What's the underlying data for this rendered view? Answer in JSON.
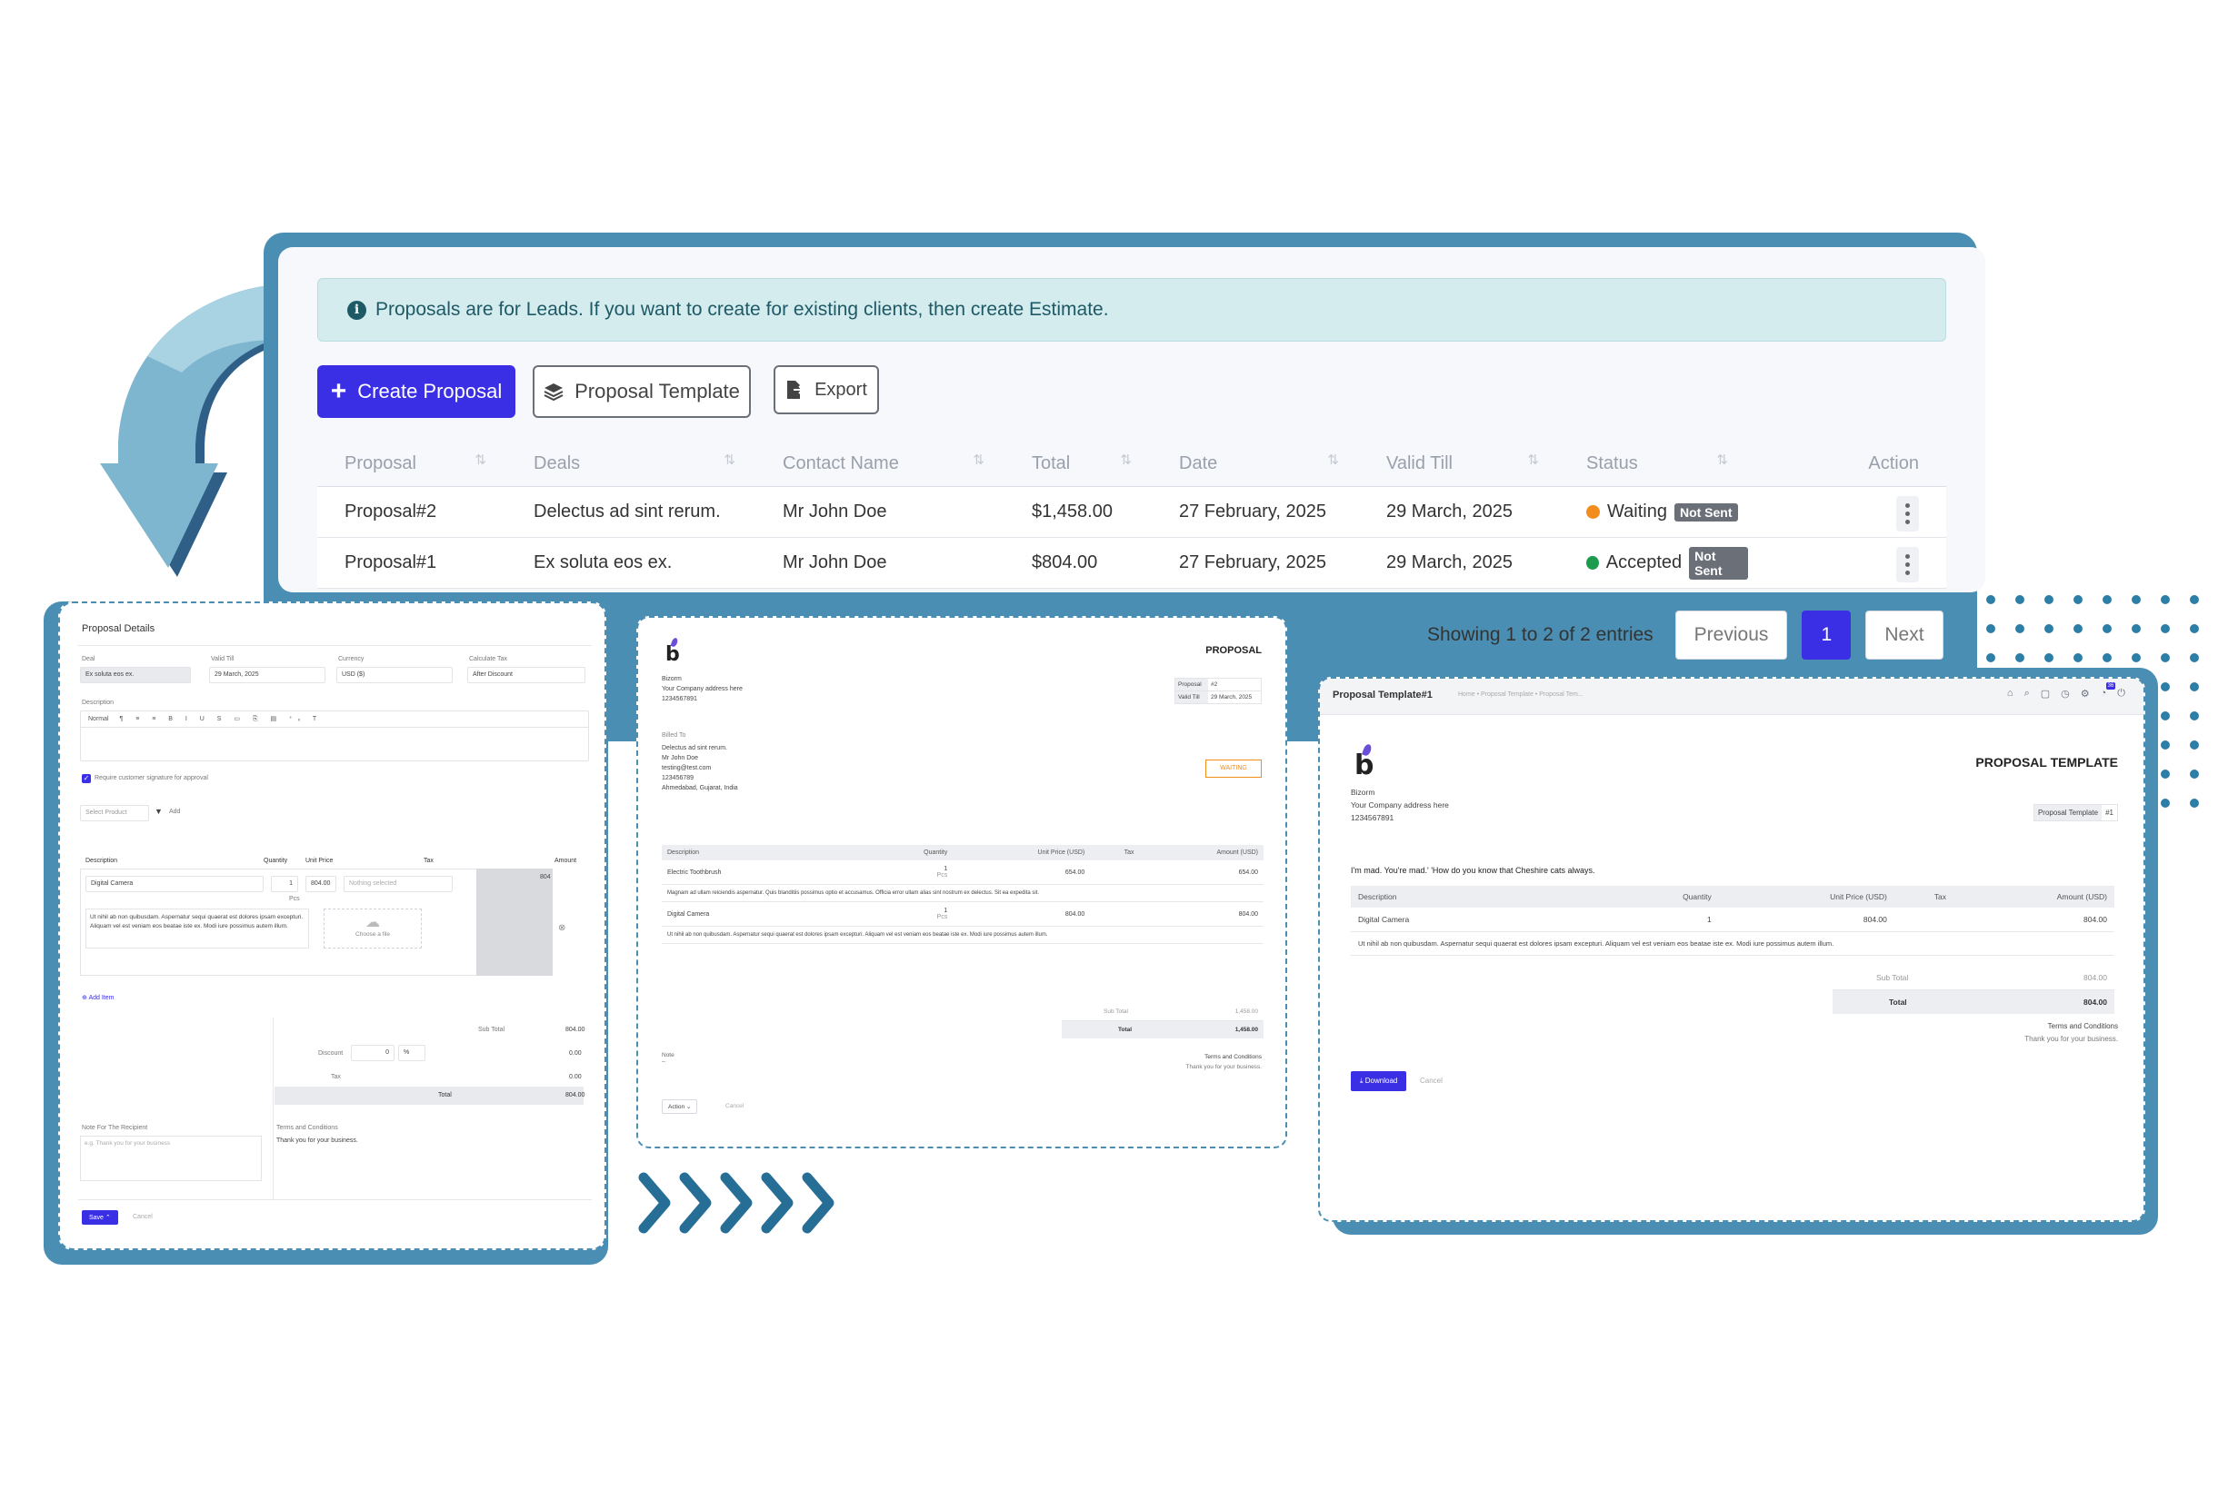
{
  "alert": {
    "icon": "info-icon",
    "text": "Proposals are for Leads. If you want to create for existing clients, then create Estimate."
  },
  "toolbar": {
    "create_label": "Create Proposal",
    "template_label": "Proposal Template",
    "export_label": "Export"
  },
  "table": {
    "headers": [
      "Proposal",
      "Deals",
      "Contact Name",
      "Total",
      "Date",
      "Valid Till",
      "Status",
      "Action"
    ],
    "rows": [
      {
        "proposal": "Proposal#2",
        "deal": "Delectus ad sint rerum.",
        "contact": "Mr John Doe",
        "total": "$1,458.00",
        "date": "27 February, 2025",
        "valid": "29 March, 2025",
        "status": "Waiting",
        "status_color": "#f28c1c",
        "badge": "Not Sent"
      },
      {
        "proposal": "Proposal#1",
        "deal": "Ex soluta eos ex.",
        "contact": "Mr John Doe",
        "total": "$804.00",
        "date": "27 February, 2025",
        "valid": "29 March, 2025",
        "status": "Accepted",
        "status_color": "#1c9a4e",
        "badge": "Not Sent"
      }
    ]
  },
  "pager": {
    "info": "Showing 1 to 2 of 2 entries",
    "prev": "Previous",
    "page": "1",
    "next": "Next"
  },
  "left": {
    "title": "Proposal Details",
    "deal_label": "Deal",
    "deal_value": "Ex soluta eos ex.",
    "valid_label": "Valid Till",
    "valid_value": "29 March, 2025",
    "currency_label": "Currency",
    "currency_value": "USD ($)",
    "calc_label": "Calculate Tax",
    "calc_value": "After Discount",
    "desc_label": "Description",
    "editor_style": "Normal",
    "signature_label": "Require customer signature for approval",
    "select_product": "Select Product",
    "add": "Add",
    "cols": [
      "Description",
      "Quantity",
      "Unit Price",
      "Tax",
      "Amount"
    ],
    "item_name": "Digital Camera",
    "item_qty": "1",
    "item_unit": "Pcs",
    "item_price": "804.00",
    "item_tax": "Nothing selected",
    "item_amount": "804",
    "item_desc": "Ut nihil ab non quibusdam. Aspernatur sequi quaerat est dolores ipsam excepturi. Aliquam vel est veniam eos beatae iste ex. Modi iure possimus autem illum.",
    "choose_file": "Choose a file",
    "add_item": "Add Item",
    "sub_total_label": "Sub Total",
    "sub_total": "804.00",
    "discount_label": "Discount",
    "discount_value": "0",
    "discount_type": "%",
    "discount_amount": "0.00",
    "tax_label": "Tax",
    "tax_amount": "0.00",
    "total_label": "Total",
    "total": "804.00",
    "note_label": "Note For The Recipient",
    "note_placeholder": "e.g. Thank you for your business",
    "terms_label": "Terms and Conditions",
    "terms_text": "Thank you for your business.",
    "save": "Save",
    "cancel": "Cancel"
  },
  "middle": {
    "heading": "PROPOSAL",
    "company": "Bizorm",
    "address": "Your Company address here",
    "phone": "1234567891",
    "proposal_label": "Proposal",
    "proposal_no": "#2",
    "valid_label": "Valid Till",
    "valid_value": "29 March, 2025",
    "billed_to": "Billed To",
    "client_lines": [
      "Delectus ad sint rerum.",
      "Mr John Doe",
      "testing@test.com",
      "123456789",
      "Ahmedabad, Gujarat, India"
    ],
    "status": "WAITING",
    "cols": [
      "Description",
      "Quantity",
      "Unit Price (USD)",
      "Tax",
      "Amount (USD)"
    ],
    "items": [
      {
        "name": "Electric Toothbrush",
        "qty": "1",
        "unit": "Pcs",
        "price": "654.00",
        "amount": "654.00",
        "desc": "Magnam ad ullam reiciendis aspernatur. Quis blanditiis possimus optio et accusamus. Officia error ullam alias sint nostrum ex delectus. Sit ea expedita sit."
      },
      {
        "name": "Digital Camera",
        "qty": "1",
        "unit": "Pcs",
        "price": "804.00",
        "amount": "804.00",
        "desc": "Ut nihil ab non quibusdam. Aspernatur sequi quaerat est dolores ipsam excepturi. Aliquam vel est veniam eos beatae iste ex. Modi iure possimus autem illum."
      }
    ],
    "sub_total_label": "Sub Total",
    "sub_total": "1,458.00",
    "total_label": "Total",
    "total": "1,458.00",
    "note_label": "Note",
    "note_value": "--",
    "terms_label": "Terms and Conditions",
    "terms_text": "Thank you for your business.",
    "action": "Action",
    "cancel": "Cancel"
  },
  "right": {
    "title": "Proposal Template#1",
    "breadcrumb": "Home • Proposal Template • Proposal Tem...",
    "notif_count": "36",
    "heading": "PROPOSAL TEMPLATE",
    "company": "Bizorm",
    "address": "Your Company address here",
    "phone": "1234567891",
    "template_label": "Proposal Template",
    "template_no": "#1",
    "intro": "I'm mad. You're mad.' 'How do you know that Cheshire cats always.",
    "cols": [
      "Description",
      "Quantity",
      "Unit Price (USD)",
      "Tax",
      "Amount (USD)"
    ],
    "item_name": "Digital Camera",
    "item_qty": "1",
    "item_price": "804.00",
    "item_amount": "804.00",
    "item_desc": "Ut nihil ab non quibusdam. Aspernatur sequi quaerat est dolores ipsam excepturi. Aliquam vel est veniam eos beatae iste ex. Modi iure possimus autem illum.",
    "sub_total_label": "Sub Total",
    "sub_total": "804.00",
    "total_label": "Total",
    "total": "804.00",
    "terms_label": "Terms and Conditions",
    "terms_text": "Thank you for your business.",
    "download": "Download",
    "cancel": "Cancel"
  }
}
